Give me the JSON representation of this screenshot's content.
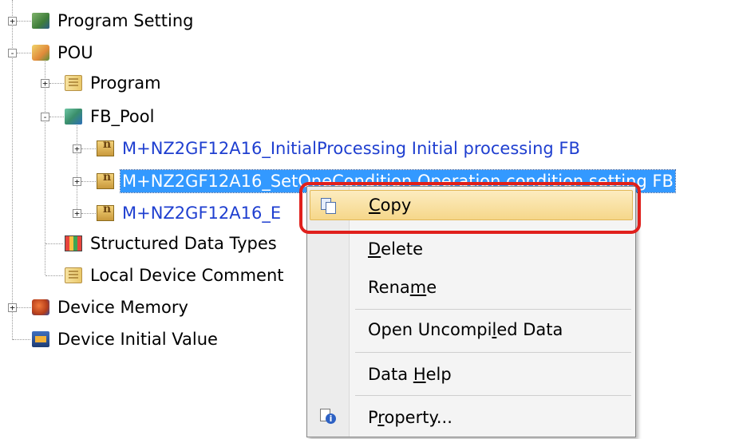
{
  "tree": {
    "program_setting": "Program Setting",
    "pou": "POU",
    "program": "Program",
    "fb_pool": "FB_Pool",
    "fb_items": [
      "M+NZ2GF12A16_InitialProcessing Initial processing FB",
      "M+NZ2GF12A16_SetOneCondition Operation condition setting FB",
      "M+NZ2GF12A16_E"
    ],
    "structured_data_types": "Structured Data Types",
    "local_device_comment": "Local Device Comment",
    "device_memory": "Device Memory",
    "device_initial_value": "Device Initial Value",
    "toggle_plus": "+",
    "toggle_minus": "-"
  },
  "context_menu": {
    "copy": {
      "pre": "",
      "u": "C",
      "post": "opy"
    },
    "delete": {
      "pre": "",
      "u": "D",
      "post": "elete"
    },
    "rename": {
      "pre": "Rena",
      "u": "m",
      "post": "e"
    },
    "open_uncompiled": {
      "pre": "Open Uncompi",
      "u": "l",
      "post": "ed Data"
    },
    "data_help": {
      "pre": "Data ",
      "u": "H",
      "post": "elp"
    },
    "property": {
      "pre": "P",
      "u": "r",
      "post": "operty..."
    }
  },
  "colors": {
    "fb_link": "#1f3fd0",
    "selection": "#3399ff",
    "menu_hover": "#f6d78a",
    "highlight_box": "#e0201c"
  },
  "icons": {
    "program_setting": "program-setting-icon",
    "pou": "pou-icon",
    "program": "program-book-icon",
    "fb_pool": "fb-pool-icon",
    "fb": "function-block-icon",
    "structured": "structured-data-icon",
    "local_comment": "comment-book-icon",
    "device_memory": "device-memory-icon",
    "device_initial": "device-initial-value-icon",
    "copy": "copy-icon",
    "property": "property-info-icon"
  }
}
